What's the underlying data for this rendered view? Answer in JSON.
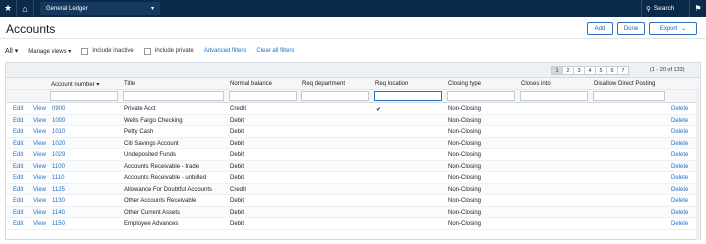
{
  "topbar": {
    "module_label": "General Ledger",
    "search_label": "Search"
  },
  "page": {
    "title": "Accounts"
  },
  "actions": {
    "add": "Add",
    "done": "Done",
    "export": "Export"
  },
  "filters": {
    "view_selector": "All",
    "manage_views": "Manage views",
    "include_inactive": "Include inactive",
    "include_private": "Include private",
    "advanced_filters": "Advanced filters",
    "clear_all_filters": "Clear all filters"
  },
  "pagination": {
    "pages": [
      "1",
      "2",
      "3",
      "4",
      "5",
      "6",
      "7"
    ],
    "active_page": "1",
    "range_text": "(1 - 20 of 133)"
  },
  "columns": {
    "account_number": "Account number",
    "title": "Title",
    "normal_balance": "Normal balance",
    "req_department": "Req department",
    "req_location": "Req location",
    "closing_type": "Closing type",
    "closes_into": "Closes into",
    "disallow_direct_posting": "Disallow Direct Posting"
  },
  "row_actions": {
    "edit": "Edit",
    "view": "View",
    "delete": "Delete"
  },
  "rows": [
    {
      "account_number": "0900",
      "title": "Private Acct",
      "normal_balance": "Credit",
      "req_location": "✔",
      "closing_type": "Non-Closing"
    },
    {
      "account_number": "1000",
      "title": "Wells Fargo Checking",
      "normal_balance": "Debit",
      "req_location": "",
      "closing_type": "Non-Closing"
    },
    {
      "account_number": "1010",
      "title": "Petty Cash",
      "normal_balance": "Debit",
      "req_location": "",
      "closing_type": "Non-Closing"
    },
    {
      "account_number": "1020",
      "title": "Citi Savings Account",
      "normal_balance": "Debit",
      "req_location": "",
      "closing_type": "Non-Closing"
    },
    {
      "account_number": "1029",
      "title": "Undeposited Funds",
      "normal_balance": "Debit",
      "req_location": "",
      "closing_type": "Non-Closing"
    },
    {
      "account_number": "1100",
      "title": "Accounts Receivable - trade",
      "normal_balance": "Debit",
      "req_location": "",
      "closing_type": "Non-Closing"
    },
    {
      "account_number": "1110",
      "title": "Accounts Receivable - unbilled",
      "normal_balance": "Debit",
      "req_location": "",
      "closing_type": "Non-Closing"
    },
    {
      "account_number": "1125",
      "title": "Allowance For Doubtful Accounts",
      "normal_balance": "Credit",
      "req_location": "",
      "closing_type": "Non-Closing"
    },
    {
      "account_number": "1130",
      "title": "Other Accounts Receivable",
      "normal_balance": "Debit",
      "req_location": "",
      "closing_type": "Non-Closing"
    },
    {
      "account_number": "1140",
      "title": "Other Current Assets",
      "normal_balance": "Debit",
      "req_location": "",
      "closing_type": "Non-Closing"
    },
    {
      "account_number": "1150",
      "title": "Employee Advances",
      "normal_balance": "Debit",
      "req_location": "",
      "closing_type": "Non-Closing"
    }
  ]
}
